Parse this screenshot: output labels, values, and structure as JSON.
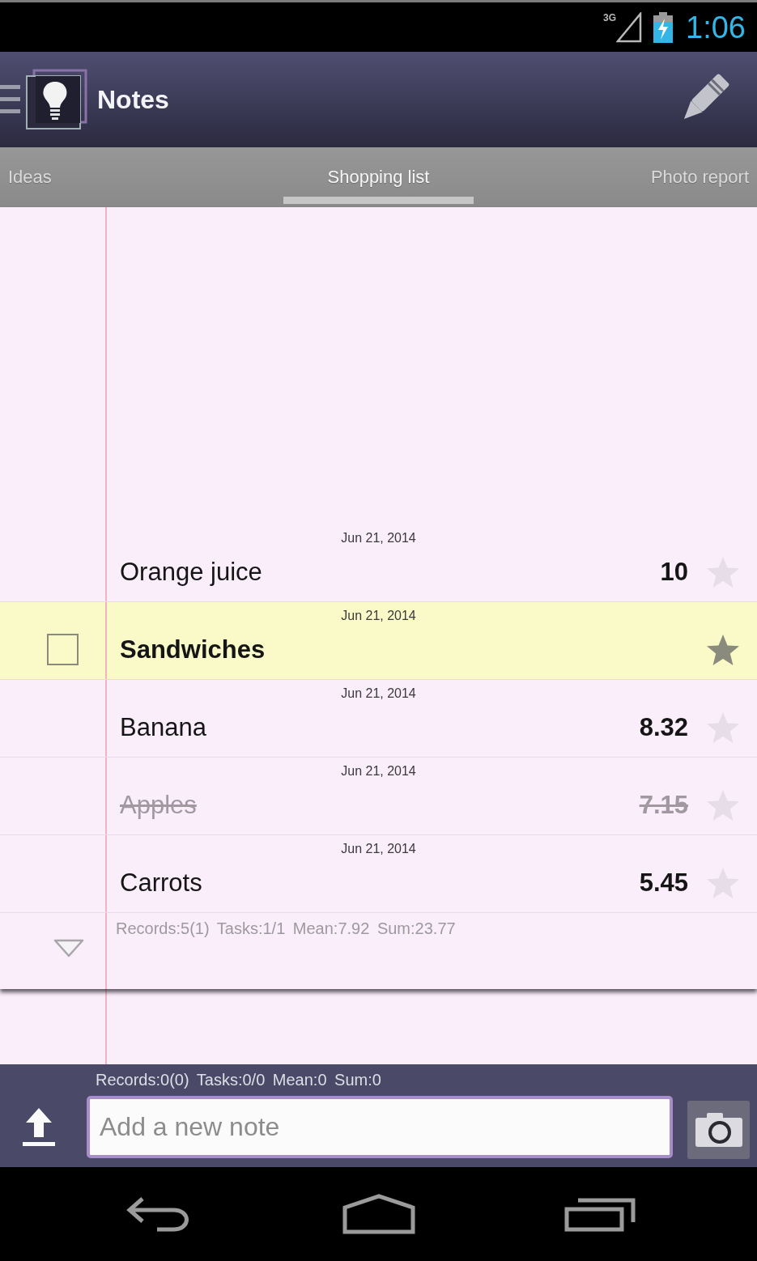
{
  "status_bar": {
    "network": "3G",
    "time": "1:06"
  },
  "action_bar": {
    "title": "Notes"
  },
  "tabs": [
    {
      "label": "Ideas",
      "selected": false
    },
    {
      "label": "Shopping list",
      "selected": true
    },
    {
      "label": "Photo report",
      "selected": false
    }
  ],
  "notes": [
    {
      "date": "Jun 21, 2014",
      "text": "Orange juice",
      "value": "10",
      "selected": false,
      "starred": false,
      "done": false
    },
    {
      "date": "Jun 21, 2014",
      "text": "Sandwiches",
      "selected": true,
      "starred": true,
      "done": false,
      "checkbox": {
        "checked": false
      }
    },
    {
      "date": "Jun 21, 2014",
      "text": "Banana",
      "value": "8.32",
      "selected": false,
      "starred": false,
      "done": false
    },
    {
      "date": "Jun 21, 2014",
      "text": "Apples",
      "value": "7.15",
      "selected": false,
      "starred": false,
      "done": true
    },
    {
      "date": "Jun 21, 2014",
      "text": "Carrots",
      "value": "5.45",
      "selected": false,
      "starred": false,
      "done": false
    }
  ],
  "list_summary": "Records:5(1) Tasks:1/1 Mean:7.92 Sum:23.77",
  "composer": {
    "summary": "Records:0(0) Tasks:0/0 Mean:0 Sum:0",
    "placeholder": "Add a new note"
  }
}
